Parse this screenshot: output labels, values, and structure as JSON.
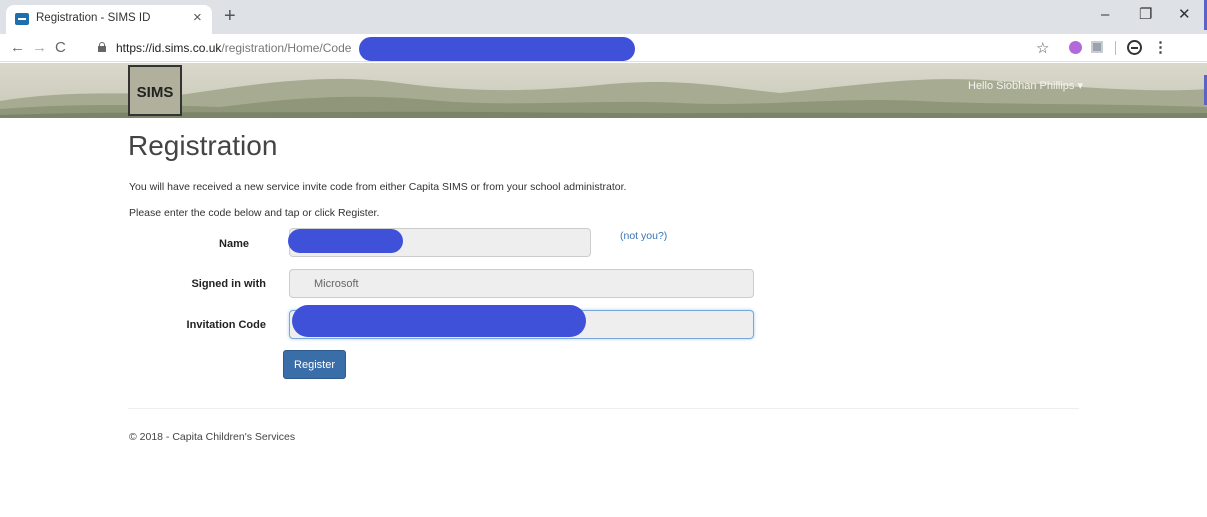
{
  "browser": {
    "tab_title": "Registration - SIMS ID",
    "tab_close": "×",
    "new_tab": "+",
    "win_min": "–",
    "win_max": "❐",
    "win_close": "✕",
    "back": "←",
    "forward": "→",
    "reload": "C",
    "url_host": "https://id.sims.co.uk",
    "url_path": "/registration/Home/Code",
    "star": "☆",
    "menu": "⋮"
  },
  "header": {
    "logo_text": "SIMS",
    "greeting": "Hello Siobhan Phillips ▾"
  },
  "main": {
    "title": "Registration",
    "intro_1": "You will have received a new service invite code from either Capita SIMS or from your school administrator.",
    "intro_2": "Please enter the code below and tap or click Register.",
    "form": {
      "name_label": "Name",
      "not_you_link": "(not you?)",
      "signed_in_label": "Signed in with",
      "signed_in_value": "Microsoft",
      "invitation_label": "Invitation Code",
      "register_button": "Register"
    }
  },
  "footer": {
    "copyright": "© 2018 - Capita Children's Services"
  },
  "colors": {
    "accent": "#3a6ea8",
    "link": "#3a73b7",
    "redaction": "#3f51d9"
  },
  "icons": [
    "lock-icon",
    "star-icon",
    "extension-icon",
    "profile-icon",
    "menu-icon"
  ]
}
